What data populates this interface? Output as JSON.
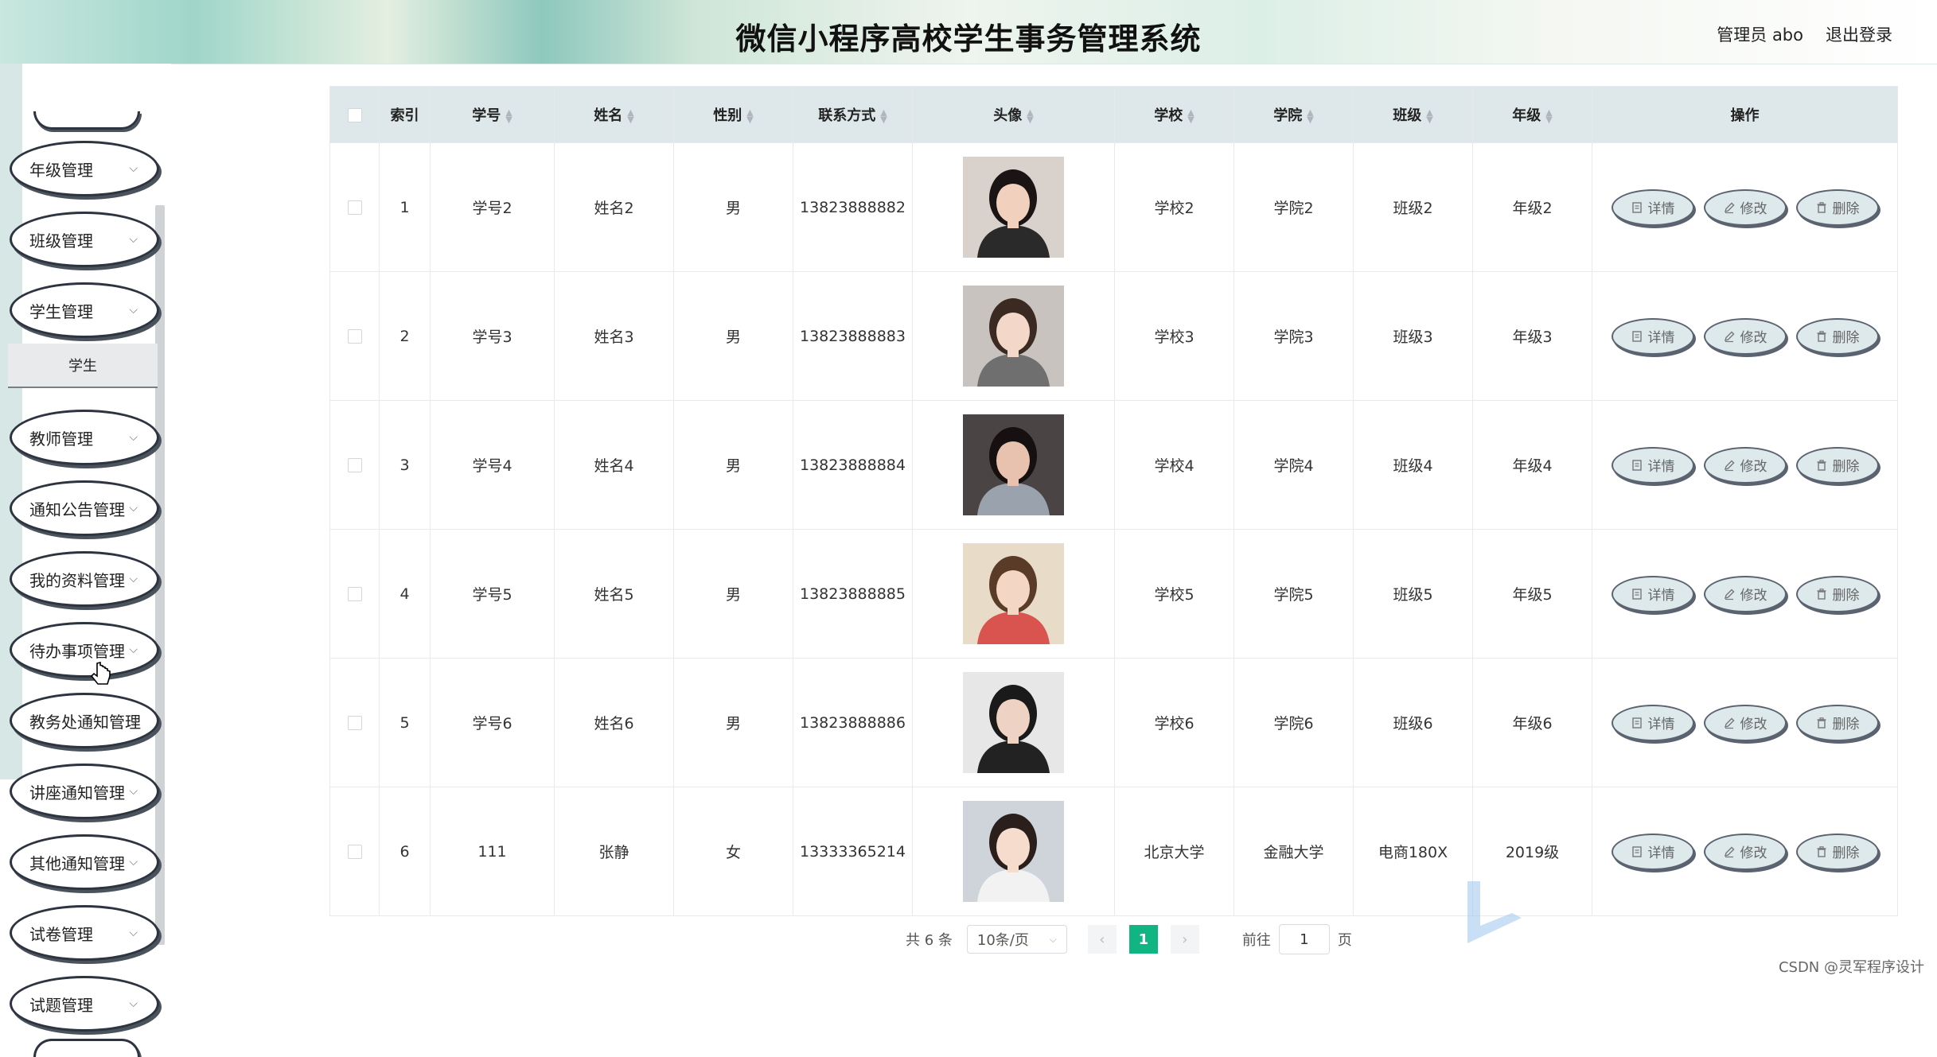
{
  "header": {
    "title": "微信小程序高校学生事务管理系统",
    "admin": "管理员 abo",
    "logout": "退出登录"
  },
  "sidebar": {
    "items": [
      {
        "label": "年级管理"
      },
      {
        "label": "班级管理"
      },
      {
        "label": "学生管理"
      },
      {
        "label": "教师管理"
      },
      {
        "label": "通知公告管理"
      },
      {
        "label": "我的资料管理"
      },
      {
        "label": "待办事项管理"
      },
      {
        "label": "教务处通知管理"
      },
      {
        "label": "讲座通知管理"
      },
      {
        "label": "其他通知管理"
      },
      {
        "label": "试卷管理"
      },
      {
        "label": "试题管理"
      }
    ],
    "submenu_item": "学生"
  },
  "table": {
    "columns": {
      "index": "索引",
      "student_no": "学号",
      "name": "姓名",
      "gender": "性别",
      "contact": "联系方式",
      "avatar": "头像",
      "school": "学校",
      "college": "学院",
      "class": "班级",
      "grade": "年级",
      "ops": "操作"
    },
    "rows": [
      {
        "index": "1",
        "student_no": "学号2",
        "name": "姓名2",
        "gender": "男",
        "contact": "13823888882",
        "school": "学校2",
        "college": "学院2",
        "class": "班级2",
        "grade": "年级2"
      },
      {
        "index": "2",
        "student_no": "学号3",
        "name": "姓名3",
        "gender": "男",
        "contact": "13823888883",
        "school": "学校3",
        "college": "学院3",
        "class": "班级3",
        "grade": "年级3"
      },
      {
        "index": "3",
        "student_no": "学号4",
        "name": "姓名4",
        "gender": "男",
        "contact": "13823888884",
        "school": "学校4",
        "college": "学院4",
        "class": "班级4",
        "grade": "年级4"
      },
      {
        "index": "4",
        "student_no": "学号5",
        "name": "姓名5",
        "gender": "男",
        "contact": "13823888885",
        "school": "学校5",
        "college": "学院5",
        "class": "班级5",
        "grade": "年级5"
      },
      {
        "index": "5",
        "student_no": "学号6",
        "name": "姓名6",
        "gender": "男",
        "contact": "13823888886",
        "school": "学校6",
        "college": "学院6",
        "class": "班级6",
        "grade": "年级6"
      },
      {
        "index": "6",
        "student_no": "111",
        "name": "张静",
        "gender": "女",
        "contact": "13333365214",
        "school": "北京大学",
        "college": "金融大学",
        "class": "电商180X",
        "grade": "2019级"
      }
    ],
    "ops": {
      "detail": "详情",
      "edit": "修改",
      "delete": "删除"
    }
  },
  "pagination": {
    "total": "共 6 条",
    "page_size": "10条/页",
    "current_page": "1",
    "goto_prefix": "前往",
    "goto_value": "1",
    "goto_suffix": "页"
  },
  "watermark": "CSDN @灵军程序设计"
}
